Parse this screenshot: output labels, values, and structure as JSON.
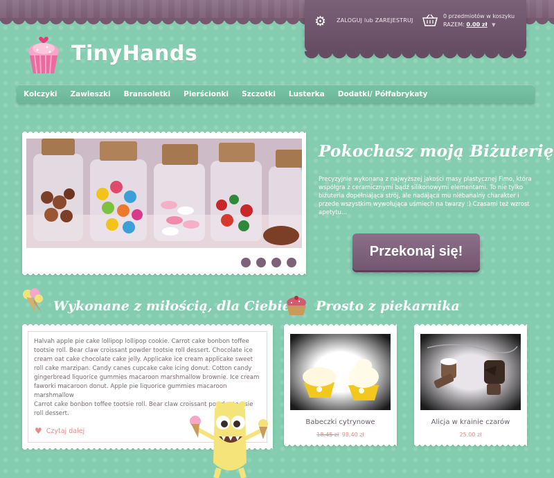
{
  "header": {
    "login_label": "ZALOGUJ lub ZAREJESTRUJ",
    "cart_count": "0 przedmiotów w koszyku",
    "cart_total_label": "RAZEM:",
    "cart_total_value": "0.00 zł"
  },
  "brand": {
    "name": "TinyHands"
  },
  "nav": {
    "items": [
      "Kolczyki",
      "Zawieszki",
      "Bransoletki",
      "Pierścionki",
      "Szczotki",
      "Lusterka",
      "Dodatki/ Półfabrykaty"
    ]
  },
  "hero": {
    "title": "Pokochasz moją Biżuterię",
    "text": "Precyzyjnie wykonana z najwyższej jakości masy plastycznej Fimo, która współgra z ceramicznymi bądź silikonowymi elementami. To nie tylko biżuteria dopełniająca strój, ale nadająca mu niebanalny charakter i przede wszystkim wywołująca uśmiech na twarzy :) Czasami też wzrost apetytu...",
    "cta": "Przekonaj się!",
    "slides": 4
  },
  "sections": {
    "left_title": "Wykonane z miłością, dla Ciebie",
    "right_title": "Prosto z piekarnika"
  },
  "about": {
    "paragraph1": "Halvah apple pie cake lollipop lollipop cookie. Carrot cake bonbon toffee tootsie roll. Bear claw croissant powder tootsie roll dessert. Chocolate ice cream oat cake chocolate cake jelly. Applicake ice cream applicake sweet roll cake marzipan. Candy canes cupcake cake icing donut. Cotton candy gingerbread liquorice gummies macaroon marshmallow brownie. Ice cream faworki macaroon donut. Apple pie liquorice gummies macaroon marshmallow",
    "paragraph2": "Carrot cake bonbon toffee tootsie roll. Bear claw croissant powder tootsie roll dessert.",
    "read_more": "Czytaj dalej"
  },
  "products": [
    {
      "name": "Babeczki cytrynowe",
      "old_price": "18.45 zł",
      "price": "98.40 zł"
    },
    {
      "name": "Alicja w krainie czarów",
      "price": "25.00 zł"
    }
  ],
  "colors": {
    "background": "#84cdb0",
    "accent": "#76596f",
    "price": "#e28c87"
  }
}
